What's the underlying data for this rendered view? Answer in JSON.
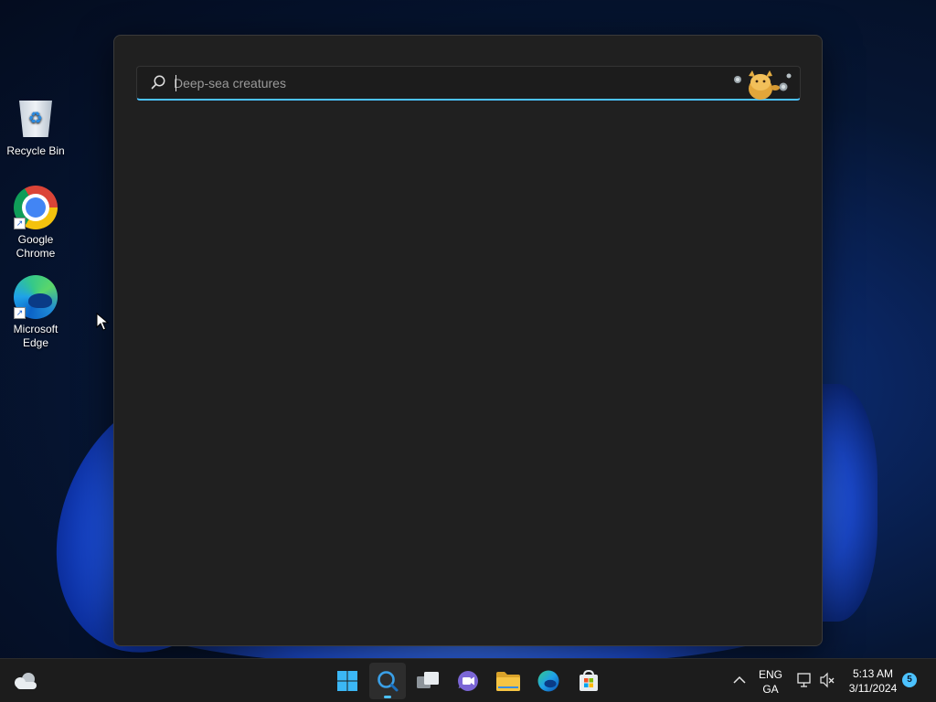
{
  "desktop": {
    "icons": [
      {
        "label": "Recycle Bin",
        "icon": "recycle-bin-icon"
      },
      {
        "label": "Google Chrome",
        "icon": "chrome-icon"
      },
      {
        "label": "Microsoft Edge",
        "icon": "edge-icon"
      }
    ]
  },
  "search": {
    "placeholder": "Deep-sea creatures",
    "value": "",
    "highlight_icon": "search-highlight-illustration",
    "accent": "#4cc2ff"
  },
  "taskbar": {
    "weather_icon": "weather-cloud-icon",
    "apps": [
      {
        "name": "Start",
        "icon": "windows-start-icon"
      },
      {
        "name": "Search",
        "icon": "search-icon",
        "active": true
      },
      {
        "name": "Task View",
        "icon": "task-view-icon"
      },
      {
        "name": "Chat",
        "icon": "teams-chat-icon"
      },
      {
        "name": "File Explorer",
        "icon": "folder-icon"
      },
      {
        "name": "Microsoft Edge",
        "icon": "edge-icon"
      },
      {
        "name": "Microsoft Store",
        "icon": "store-icon"
      }
    ],
    "tray": {
      "chevron_icon": "chevron-up-icon",
      "language_line1": "ENG",
      "language_line2": "GA",
      "network_icon": "network-icon",
      "volume_icon": "volume-muted-icon",
      "time": "5:13 AM",
      "date": "3/11/2024",
      "notification_count": "5"
    }
  },
  "colors": {
    "taskbar_bg": "#1c1c1c",
    "window_bg": "#202020",
    "accent": "#4cc2ff"
  }
}
